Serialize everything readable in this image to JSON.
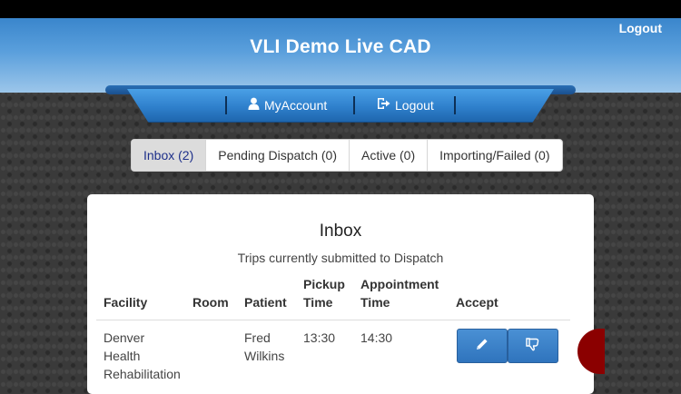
{
  "header": {
    "title": "VLI Demo Live CAD",
    "logout_label": "Logout"
  },
  "nav": {
    "my_account_label": "MyAccount",
    "logout_label": "Logout"
  },
  "tabs": [
    {
      "label": "Inbox (2)"
    },
    {
      "label": "Pending Dispatch (0)"
    },
    {
      "label": "Active (0)"
    },
    {
      "label": "Importing/Failed (0)"
    }
  ],
  "inbox": {
    "title": "Inbox",
    "subtitle": "Trips currently submitted to Dispatch",
    "columns": {
      "facility": "Facility",
      "room": "Room",
      "patient": "Patient",
      "pickup_line1": "Pickup",
      "pickup_line2": "Time",
      "appointment_line1": "Appointment",
      "appointment_line2": "Time",
      "accept": "Accept"
    },
    "rows": [
      {
        "facility_lines": [
          "Denver",
          "Health",
          "Rehabilitation"
        ],
        "room": "",
        "patient_lines": [
          "Fred",
          "Wilkins"
        ],
        "pickup_time": "13:30",
        "appointment_time": "14:30"
      }
    ]
  },
  "icons": {
    "edit": "pencil-icon",
    "reject": "thumbs-down-icon",
    "user": "user-icon",
    "logout": "logout-icon"
  }
}
